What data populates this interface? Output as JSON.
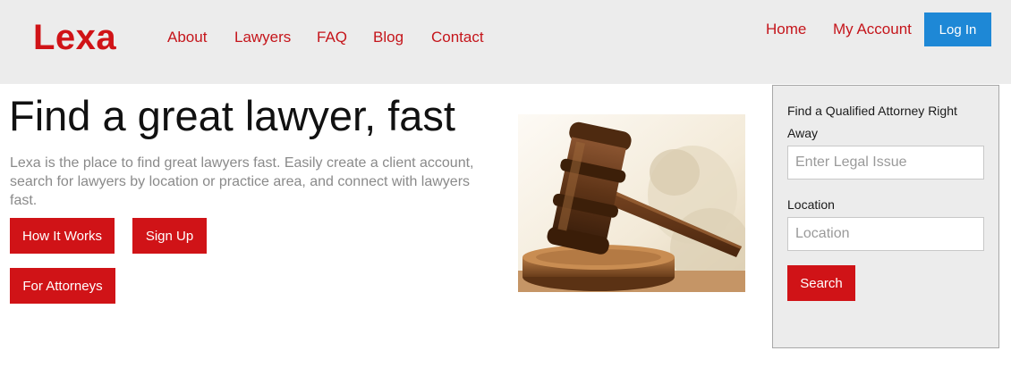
{
  "header": {
    "logo": "Lexa",
    "nav": [
      {
        "label": "About"
      },
      {
        "label": "Lawyers"
      },
      {
        "label": "FAQ"
      },
      {
        "label": "Blog"
      },
      {
        "label": "Contact"
      }
    ],
    "right_nav": [
      {
        "label": "Home"
      },
      {
        "label": "My Account"
      }
    ],
    "login_label": "Log In"
  },
  "hero": {
    "title": "Find a great lawyer, fast",
    "description": "Lexa is the place to find great lawyers fast. Easily create a client account, search for lawyers by location or practice area, and connect with lawyers fast.",
    "buttons": {
      "how_it_works": "How It Works",
      "sign_up": "Sign Up",
      "for_attorneys": "For Attorneys"
    }
  },
  "search_panel": {
    "heading": "Find a Qualified Attorney Right Away",
    "legal_issue_placeholder": "Enter Legal Issue",
    "location_label": "Location",
    "location_placeholder": "Location",
    "search_label": "Search"
  },
  "colors": {
    "brand_red": "#d01317",
    "link_red": "#c5151b",
    "login_blue": "#1e88d6",
    "header_bg": "#ececec"
  }
}
